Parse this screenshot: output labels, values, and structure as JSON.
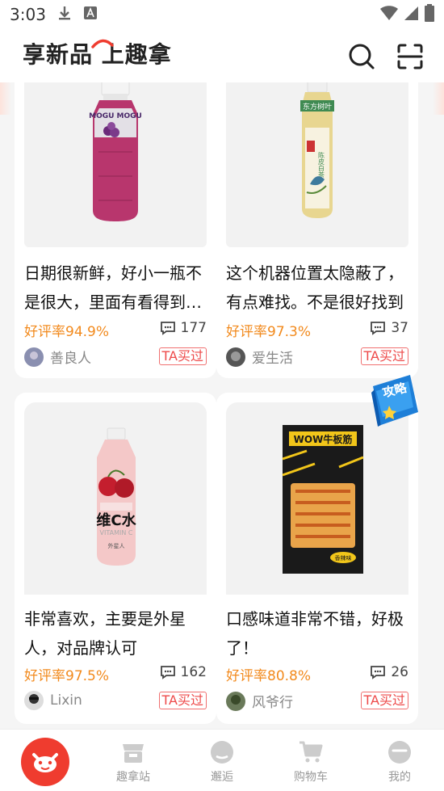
{
  "status_bar": {
    "time": "3:03"
  },
  "header": {
    "logo_text": "享新品 上趣拿"
  },
  "cards": [
    {
      "title": "日期很新鲜，好小一瓶不是很大，里面有看得到的椰果",
      "rating": "好评率94.9%",
      "comments": "177",
      "user": "善良人",
      "badge": "TA买过"
    },
    {
      "title": "这个机器位置太隐蔽了，有点难找。不是很好找到",
      "rating": "好评率97.3%",
      "comments": "37",
      "user": "爱生活",
      "badge": "TA买过"
    },
    {
      "title": "非常喜欢，主要是外星人，对品牌认可",
      "rating": "好评率97.5%",
      "comments": "162",
      "user": "Lixin",
      "badge": "TA买过"
    },
    {
      "title": "口感味道非常不错，好极了！",
      "rating": "好评率80.8%",
      "comments": "26",
      "user": "风爷行",
      "badge": "TA买过"
    }
  ],
  "products": [
    {
      "brand": "MOGU MOGU"
    },
    {
      "brand": "东方树叶",
      "sub": "陈皮白茶"
    },
    {
      "brand": "维C水",
      "sub": "VITAMIN C",
      "maker": "外星人"
    },
    {
      "brand": "WOW牛板筋",
      "tag": "香辣味"
    }
  ],
  "guide_badge": {
    "label": "攻略"
  },
  "tabbar": {
    "items": [
      {
        "label": ""
      },
      {
        "label": "趣拿站"
      },
      {
        "label": "邂逅"
      },
      {
        "label": "购物车"
      },
      {
        "label": "我的"
      }
    ]
  },
  "colors": {
    "accent": "#ef3c2f",
    "rating": "#f28a1d",
    "badge": "#ee4a4a"
  }
}
